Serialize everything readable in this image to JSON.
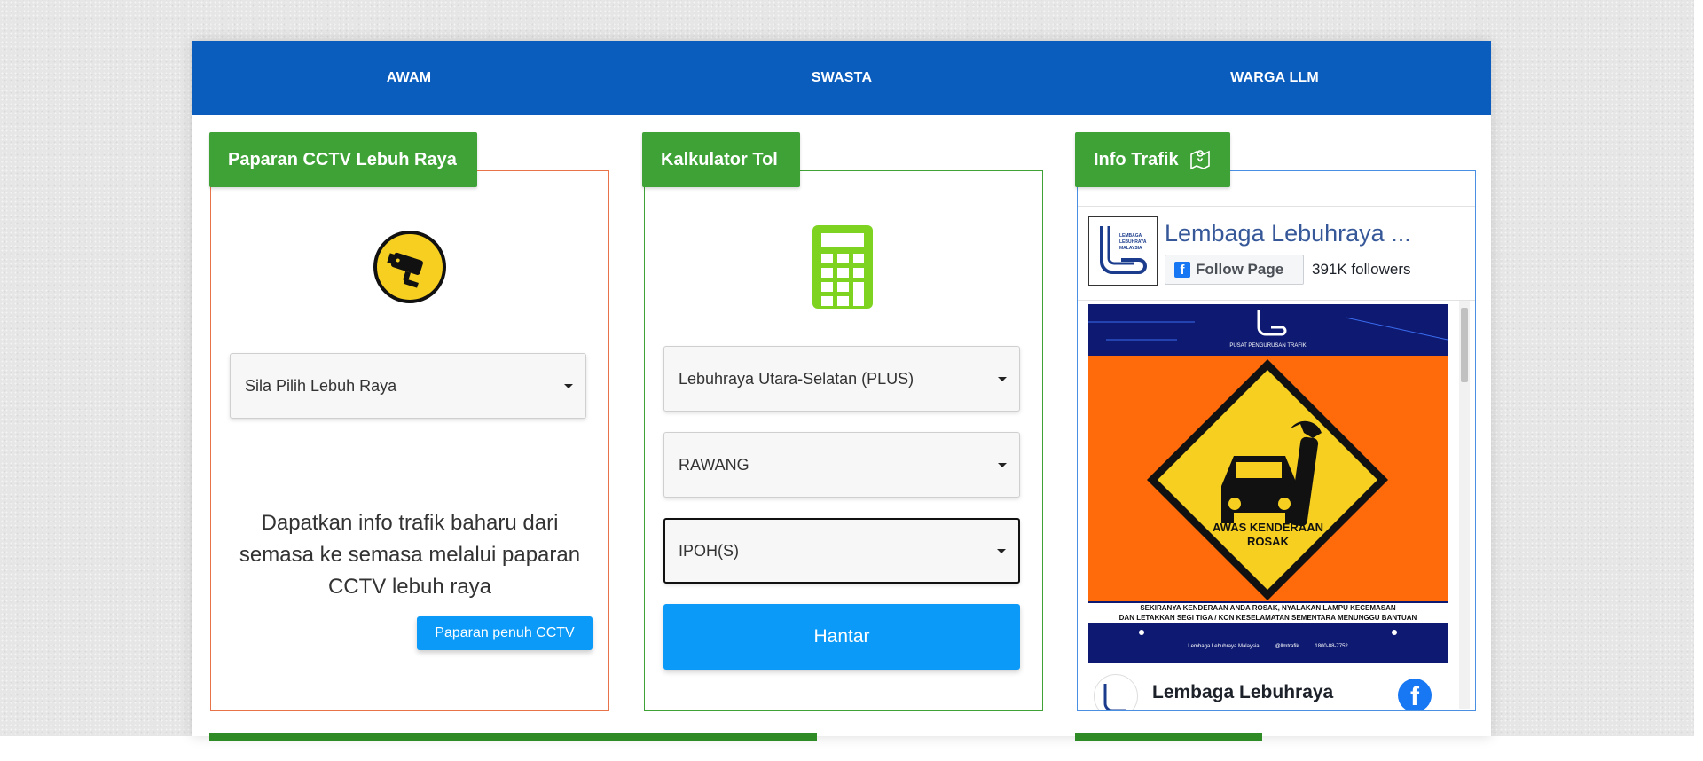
{
  "nav": {
    "tabs": [
      {
        "label": "AWAM"
      },
      {
        "label": "SWASTA"
      },
      {
        "label": "WARGA LLM"
      }
    ]
  },
  "cctv": {
    "title": "Paparan CCTV Lebuh Raya",
    "icon": "cctv-camera-icon",
    "select_value": "Sila Pilih Lebuh Raya",
    "description": "Dapatkan info trafik baharu dari semasa ke semasa melalui paparan CCTV lebuh raya",
    "button_label": "Paparan penuh CCTV"
  },
  "toll": {
    "title": "Kalkulator Tol",
    "icon": "calculator-icon",
    "highway_value": "Lebuhraya Utara-Selatan (PLUS)",
    "from_value": "RAWANG",
    "to_value": "IPOH(S)",
    "submit_label": "Hantar"
  },
  "traffic": {
    "title": "Info Trafik",
    "icon": "map-pin-icon",
    "fb": {
      "page_name": "Lembaga Lebuhraya ...",
      "follow_label": "Follow Page",
      "followers": "391K followers",
      "logo_text": [
        "LEMBAGA",
        "LEBUHRAYA",
        "MALAYSIA"
      ],
      "post": {
        "header_text": "PUSAT PENGURUSAN TRAFIK",
        "sign_line1": "AWAS KENDERAAN",
        "sign_line2": "ROSAK",
        "caption_line1": "SEKIRANYA KENDERAAN ANDA ROSAK, NYALAKAN LAMPU KECEMASAN",
        "caption_line2": "DAN LETAKKAN SEGI TIGA / KON KESELAMATAN SEMENTARA MENUNGGU BANTUAN",
        "footer_items": [
          "Lembaga Lebuhraya Malaysia",
          "@llmtrafik",
          "1800-88-7752"
        ]
      },
      "next_post_name": "Lembaga Lebuhraya"
    }
  },
  "colors": {
    "nav": "#0a5cbd",
    "tab_green": "#3fa236",
    "cctv_border": "#e8734a",
    "toll_border": "#3fa236",
    "traffic_border": "#4a90e2",
    "submit": "#0b9af7",
    "calculator": "#7ed321",
    "sign_orange": "#ff6b0a",
    "sign_yellow": "#f6cf21"
  }
}
